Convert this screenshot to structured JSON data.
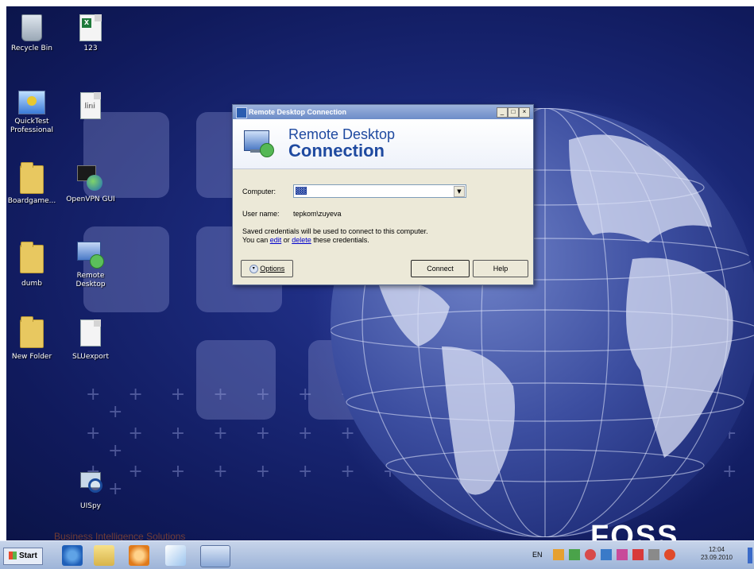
{
  "desktop": {
    "watermark_text": "FOSS",
    "faded_text": "Business Intelligence Solutions",
    "icons": [
      {
        "label": "Recycle Bin"
      },
      {
        "label": "123"
      },
      {
        "label": "QuickTest Professional"
      },
      {
        "label": "lini"
      },
      {
        "label": "Boardgame..."
      },
      {
        "label": "OpenVPN GUI"
      },
      {
        "label": "dumb"
      },
      {
        "label": "Remote Desktop"
      },
      {
        "label": "New Folder"
      },
      {
        "label": "SLUexport"
      },
      {
        "label": "UISpy"
      }
    ]
  },
  "dialog": {
    "title": "Remote Desktop Connection",
    "banner_line1": "Remote Desktop",
    "banner_line2": "Connection",
    "computer_label": "Computer:",
    "computer_value": "░░",
    "username_label": "User name:",
    "username_value": "tepkom\\zuyeva",
    "saved_line1": "Saved credentials will be used to connect to this computer.",
    "saved_line2_prefix": "You can ",
    "saved_edit": "edit",
    "saved_or": " or ",
    "saved_delete": "delete",
    "saved_suffix": " these credentials.",
    "options_label": "Options",
    "connect_label": "Connect",
    "help_label": "Help",
    "minimize": "_",
    "maximize": "□",
    "close": "×"
  },
  "taskbar": {
    "start_label": "Start",
    "language": "EN",
    "time": "12:04",
    "date": "23.09.2010"
  }
}
